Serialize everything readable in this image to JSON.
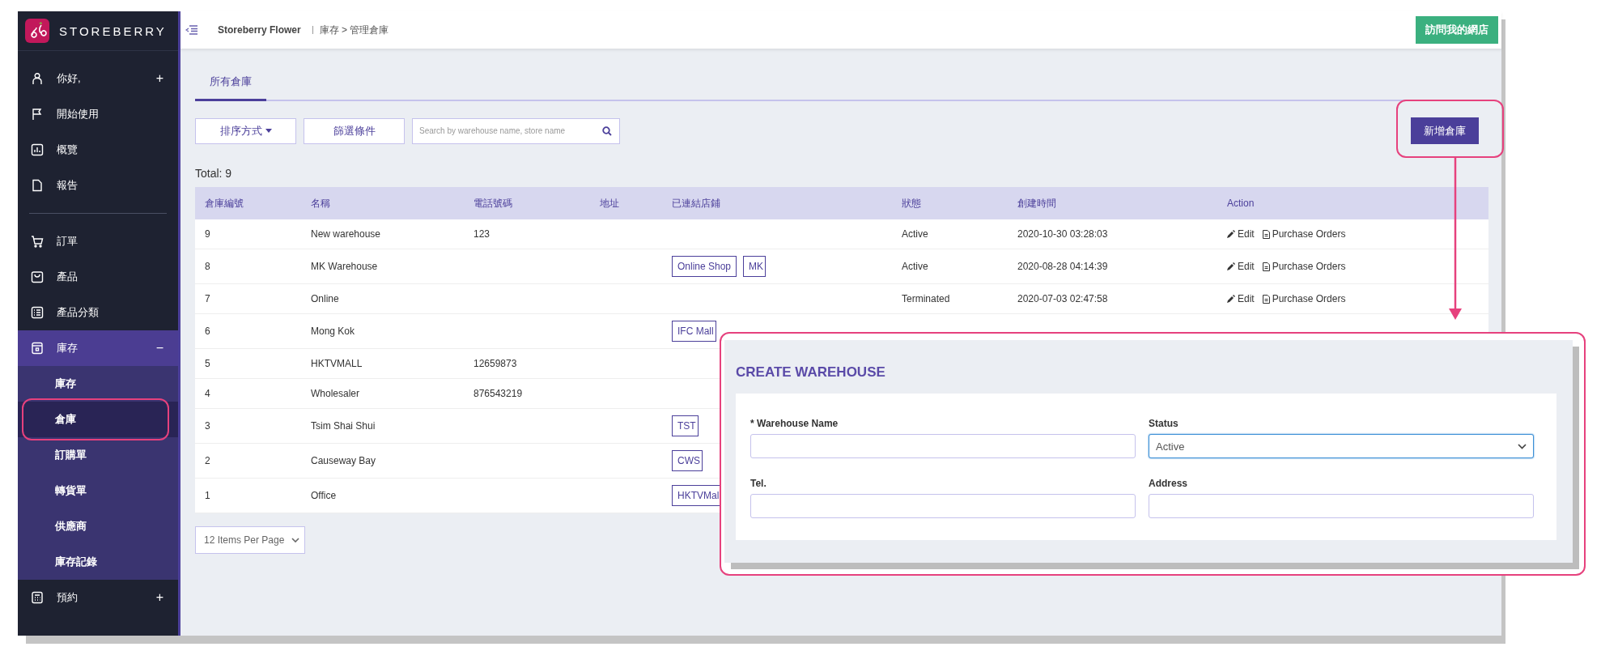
{
  "sidebar": {
    "brand": "STOREBERRY",
    "groups": [
      {
        "items": [
          {
            "label": "你好,",
            "toggle": "+",
            "selected": false
          },
          {
            "label": "開始使用",
            "selected": false
          },
          {
            "label": "概覽",
            "selected": false
          },
          {
            "label": "報告",
            "selected": false
          }
        ]
      },
      {
        "items": [
          {
            "label": "訂單",
            "selected": false
          },
          {
            "label": "產品",
            "selected": false
          },
          {
            "label": "產品分類",
            "selected": false
          },
          {
            "label": "庫存",
            "toggle": "−",
            "selected": true,
            "expanded": true,
            "children": [
              {
                "label": "庫存",
                "selected": false
              },
              {
                "label": "倉庫",
                "selected": true
              },
              {
                "label": "訂購單",
                "selected": false
              },
              {
                "label": "轉貨單",
                "selected": false
              },
              {
                "label": "供應商",
                "selected": false
              },
              {
                "label": "庫存記錄",
                "selected": false
              }
            ]
          },
          {
            "label": "預約",
            "toggle": "+",
            "selected": false
          }
        ]
      }
    ]
  },
  "header": {
    "shop": "Storeberry Flower",
    "path": "庫存 > 管理倉庫",
    "visit_button": "訪問我的網店"
  },
  "tabs": [
    {
      "label": "所有倉庫",
      "selected": true
    }
  ],
  "toolbar": {
    "sort": "排序方式",
    "filter": "篩選條件",
    "search_placeholder": "Search by warehouse name, store name",
    "add_button": "新增倉庫"
  },
  "total": "Total: 9",
  "table": {
    "columns": [
      "倉庫編號",
      "名稱",
      "電話號碼",
      "地址",
      "已連結店鋪",
      "狀態",
      "創建時間",
      "Action"
    ],
    "rows": [
      {
        "id": "9",
        "name": "New warehouse",
        "tel": "123",
        "status": "Active",
        "created": "2020-10-30 03:28:03",
        "actions": [
          "Edit",
          "Purchase Orders"
        ]
      },
      {
        "id": "8",
        "name": "MK Warehouse",
        "stores": [
          "Online Shop",
          "MK"
        ],
        "status": "Active",
        "created": "2020-08-28 04:14:39",
        "actions": [
          "Edit",
          "Purchase Orders"
        ]
      },
      {
        "id": "7",
        "name": "Online",
        "status": "Terminated",
        "created": "2020-07-03 02:47:58",
        "actions": [
          "Edit",
          "Purchase Orders"
        ]
      },
      {
        "id": "6",
        "name": "Mong Kok",
        "stores": [
          "IFC Mall"
        ]
      },
      {
        "id": "5",
        "name": "HKTVMALL",
        "tel": "12659873"
      },
      {
        "id": "4",
        "name": "Wholesaler",
        "tel": "876543219"
      },
      {
        "id": "3",
        "name": "Tsim Shai Shui",
        "stores": [
          "TST"
        ]
      },
      {
        "id": "2",
        "name": "Causeway Bay",
        "stores": [
          "CWS"
        ]
      },
      {
        "id": "1",
        "name": "Office",
        "stores": [
          "HKTVMal"
        ]
      }
    ]
  },
  "pagination": {
    "per_page": "12 Items Per Page"
  },
  "dialog": {
    "title": "CREATE WAREHOUSE",
    "fields": [
      {
        "label": "* Warehouse Name",
        "kind": "text"
      },
      {
        "label": "Status",
        "kind": "select",
        "value": "Active",
        "focused": true
      },
      {
        "label": "Tel.",
        "kind": "text"
      },
      {
        "label": "Address",
        "kind": "text"
      }
    ]
  }
}
